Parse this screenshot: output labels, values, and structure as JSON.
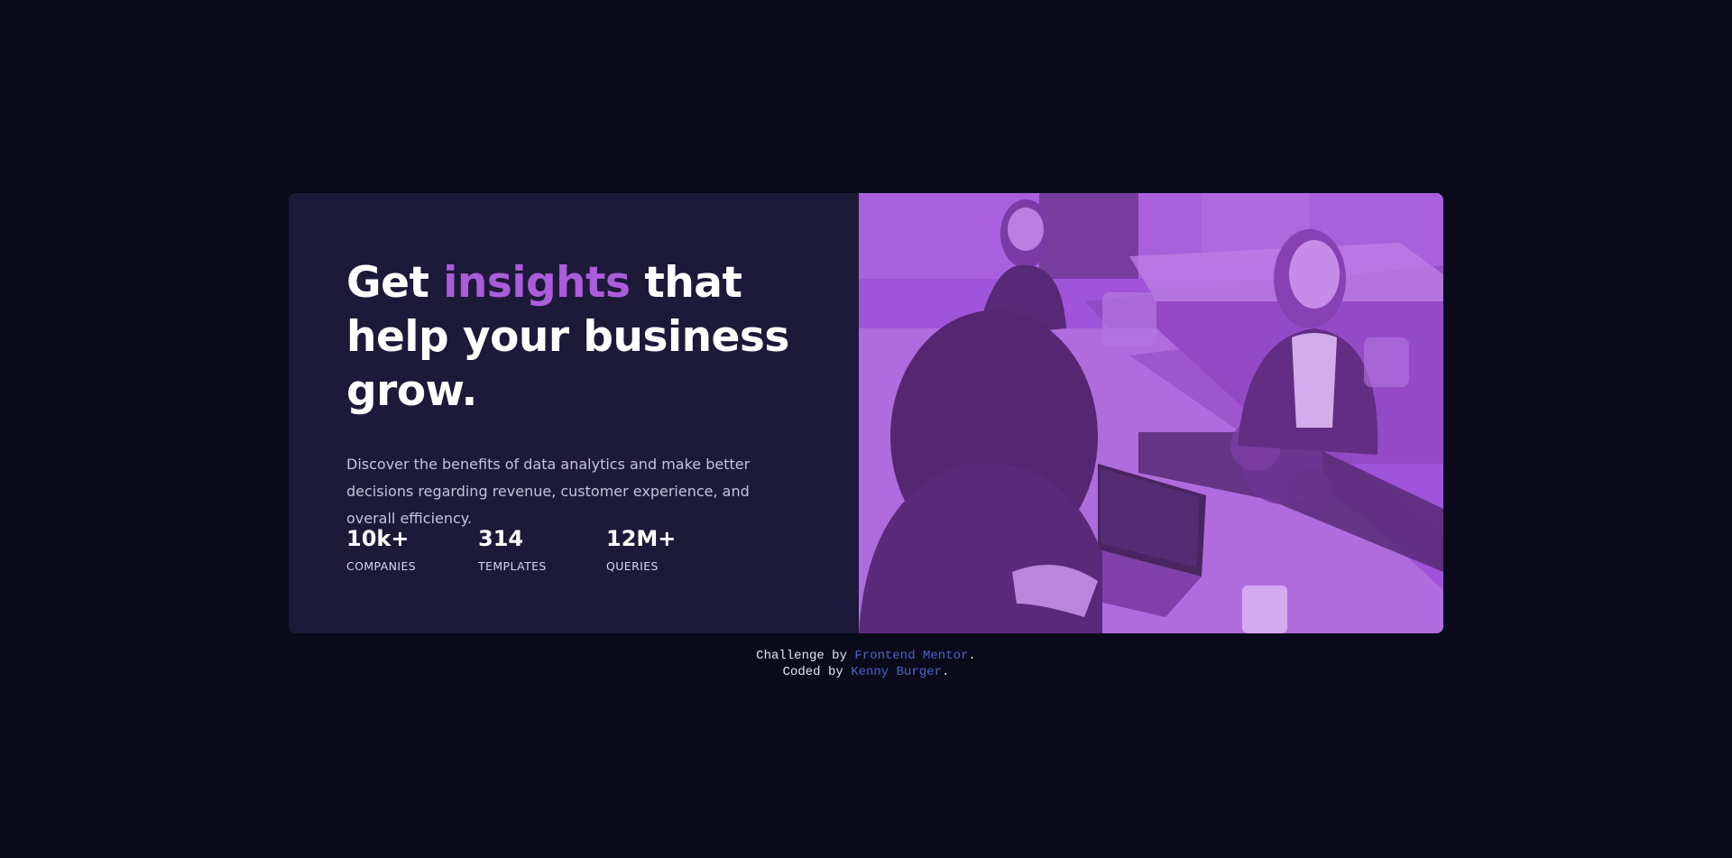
{
  "hero": {
    "title_start": "Get ",
    "title_accent": "insights",
    "title_end": " that help your business grow.",
    "description": "Discover the benefits of data analytics and make better decisions regarding revenue, customer experience, and overall efficiency."
  },
  "stats": [
    {
      "value": "10k+",
      "label": "COMPANIES"
    },
    {
      "value": "314",
      "label": "TEMPLATES"
    },
    {
      "value": "12M+",
      "label": "QUERIES"
    }
  ],
  "image": {
    "subject": "three people working at a shared desk with laptops",
    "overlay_color": "#aa5cdb"
  },
  "attribution": {
    "challenge_prefix": "Challenge by ",
    "challenge_link": "Frontend Mentor",
    "challenge_suffix": ".",
    "coded_prefix": "Coded by ",
    "coded_link": "Kenny Burger",
    "coded_suffix": "."
  },
  "colors": {
    "background": "#090b1b",
    "card": "#1c1a38",
    "accent": "#ab5cdb",
    "link": "#4e63c7"
  }
}
